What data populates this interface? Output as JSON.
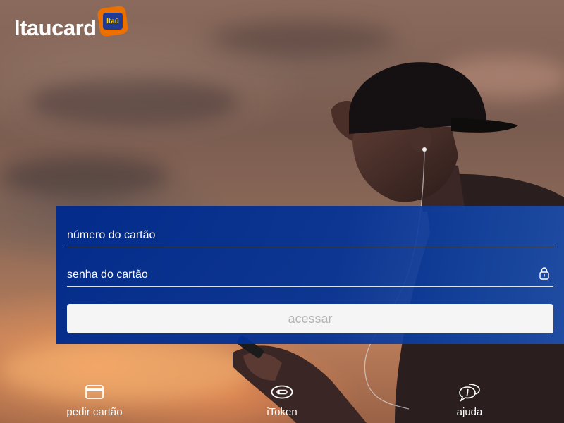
{
  "brand": {
    "name": "Itaucard",
    "badge_text": "Itaú",
    "colors": {
      "orange": "#ec7000",
      "navy": "#1f3a93",
      "yellow": "#ffd200",
      "panel_blue": "#002a8c"
    }
  },
  "login": {
    "card_number_placeholder": "número do cartão",
    "card_password_placeholder": "senha do cartão",
    "password_icon": "lock-icon",
    "submit_label": "acessar"
  },
  "bottom_nav": {
    "items": [
      {
        "label": "pedir cartão",
        "icon": "credit-card-icon"
      },
      {
        "label": "iToken",
        "icon": "token-device-icon"
      },
      {
        "label": "ajuda",
        "icon": "help-chat-icon"
      }
    ]
  }
}
